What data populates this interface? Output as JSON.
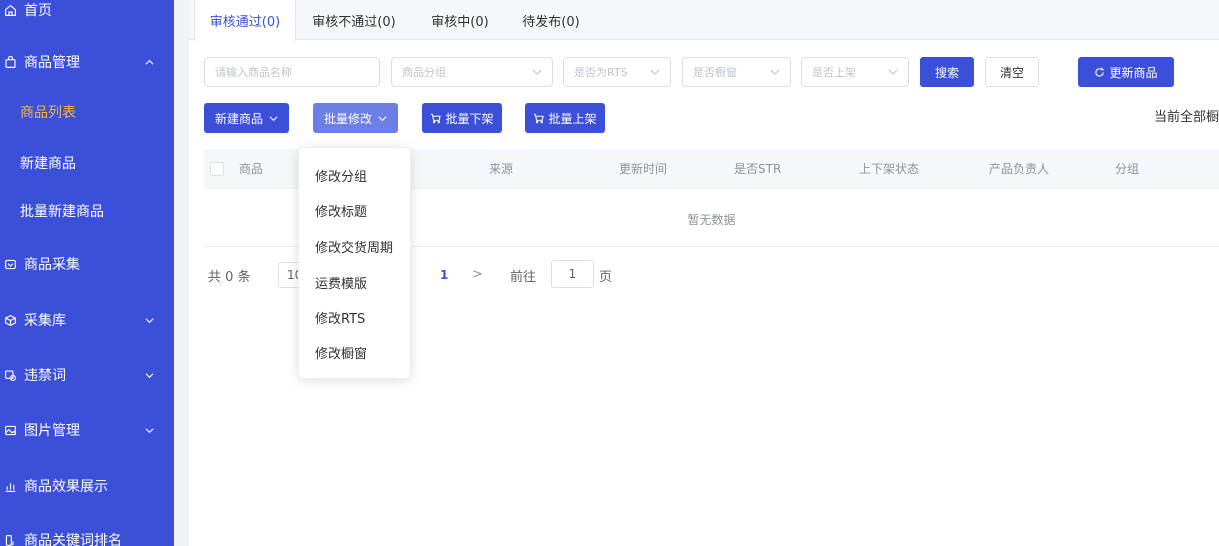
{
  "sidebar": {
    "items": [
      {
        "label": "首页",
        "icon": "home-icon"
      },
      {
        "label": "商品管理",
        "icon": "bag-icon"
      },
      {
        "label": "商品列表"
      },
      {
        "label": "新建商品"
      },
      {
        "label": "批量新建商品"
      },
      {
        "label": "商品采集",
        "icon": "collect-icon"
      },
      {
        "label": "采集库",
        "icon": "box-icon"
      },
      {
        "label": "违禁词",
        "icon": "words-icon"
      },
      {
        "label": "图片管理",
        "icon": "image-icon"
      },
      {
        "label": "商品效果展示",
        "icon": "chart-icon"
      },
      {
        "label": "商品关键词排名",
        "icon": "rank-icon"
      }
    ]
  },
  "tabs": [
    {
      "label": "审核通过(0)"
    },
    {
      "label": "审核不通过(0)"
    },
    {
      "label": "审核中(0)"
    },
    {
      "label": "待发布(0)"
    }
  ],
  "filters": {
    "name_placeholder": "请输入商品名称",
    "group_placeholder": "商品分组",
    "rts_placeholder": "是否为RTS",
    "window_placeholder": "是否橱窗",
    "shelf_placeholder": "是否上架"
  },
  "buttons": {
    "search": "搜索",
    "clear": "清空",
    "update": "更新商品",
    "new_product": "新建商品",
    "batch_edit": "批量修改",
    "batch_off": "批量下架",
    "batch_on": "批量上架"
  },
  "status_right": "当前全部橱",
  "table": {
    "columns": [
      "商品",
      "来源",
      "更新时间",
      "是否STR",
      "上下架状态",
      "产品负责人",
      "分组"
    ],
    "empty": "暂无数据"
  },
  "pagination": {
    "total": "共 0 条",
    "page_size": "10",
    "current": "1",
    "next": ">",
    "goto_label": "前往",
    "goto_value": "1",
    "page_suffix": "页"
  },
  "dropdown": {
    "items": [
      "修改分组",
      "修改标题",
      "修改交货周期",
      "运费模版",
      "修改RTS",
      "修改橱窗"
    ]
  },
  "colors": {
    "sidebar": "#3b4fd8",
    "primary": "#3b4fd8",
    "active_menu": "#f5b838"
  }
}
